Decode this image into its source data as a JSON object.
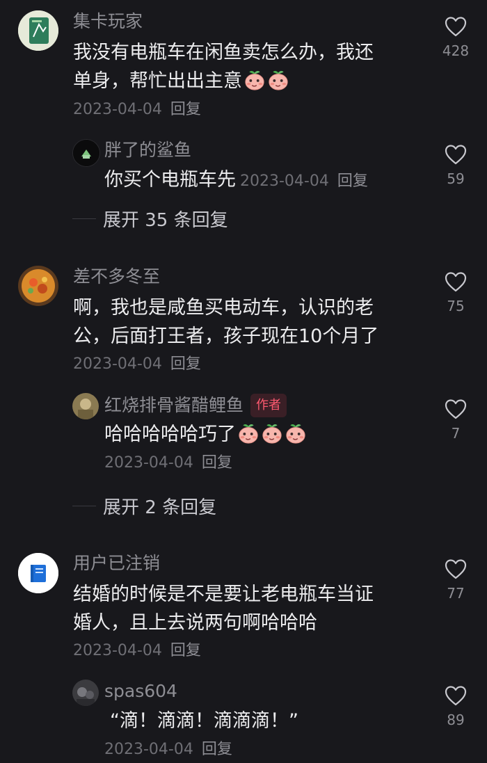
{
  "comments": [
    {
      "user": "集卡玩家",
      "lines": [
        "我没有电瓶车在闲鱼卖怎么办，我还",
        "单身，帮忙出出主意"
      ],
      "emoji_count": 2,
      "date": "2023-04-04",
      "reply": "回复",
      "likes": "428",
      "sub": {
        "user": "胖了的鲨鱼",
        "text": "你买个电瓶车先",
        "date": "2023-04-04",
        "reply": "回复",
        "likes": "59"
      },
      "expand": "展开 35 条回复"
    },
    {
      "user": "差不多冬至",
      "lines": [
        "啊，我也是咸鱼买电动车，认识的老",
        "公，后面打王者，孩子现在10个月了"
      ],
      "date": "2023-04-04",
      "reply": "回复",
      "likes": "75",
      "sub": {
        "user": "红烧排骨酱醋鲤鱼",
        "author_tag": "作者",
        "text": "哈哈哈哈哈巧了",
        "emoji_count": 3,
        "date": "2023-04-04",
        "reply": "回复",
        "likes": "7"
      },
      "expand": "展开 2 条回复"
    },
    {
      "user": "用户已注销",
      "lines": [
        "结婚的时候是不是要让老电瓶车当证",
        "婚人，且上去说两句啊哈哈哈"
      ],
      "date": "2023-04-04",
      "reply": "回复",
      "likes": "77",
      "sub": {
        "user": "spas604",
        "text": "“滴！滴滴！滴滴滴！”",
        "date": "2023-04-04",
        "reply": "回复",
        "likes": "89"
      }
    }
  ],
  "icons": {
    "like": "heart-outline-icon",
    "emoji": "peach-emoji-icon"
  },
  "colors": {
    "background": "#18181c",
    "author_tag": "#ff5a70"
  }
}
